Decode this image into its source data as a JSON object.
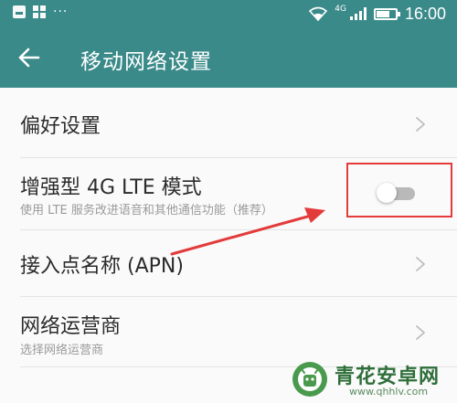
{
  "status_bar": {
    "network_type": "4G",
    "time": "16:00",
    "dots": "···"
  },
  "header": {
    "title": "移动网络设置",
    "back_icon": "arrow-left-icon"
  },
  "settings": [
    {
      "title": "偏好设置",
      "subtitle": "",
      "control": "chevron"
    },
    {
      "title": "增强型 4G LTE 模式",
      "subtitle": "使用 LTE 服务改进语音和其他通信功能（推荐）",
      "control": "toggle",
      "enabled": false
    },
    {
      "title": "接入点名称 (APN)",
      "subtitle": "",
      "control": "chevron"
    },
    {
      "title": "网络运营商",
      "subtitle": "选择网络运营商",
      "control": "chevron"
    }
  ],
  "annotation": {
    "color": "#e33b3b"
  },
  "watermark": {
    "title": "青花安卓网",
    "url": "www.qhhlv.com"
  },
  "colors": {
    "accent": "#3b8a8a",
    "background": "#fafafa",
    "text": "#2b2b2b",
    "subtext": "#9a9a9a",
    "toggle_off": "#b9b9b9"
  }
}
